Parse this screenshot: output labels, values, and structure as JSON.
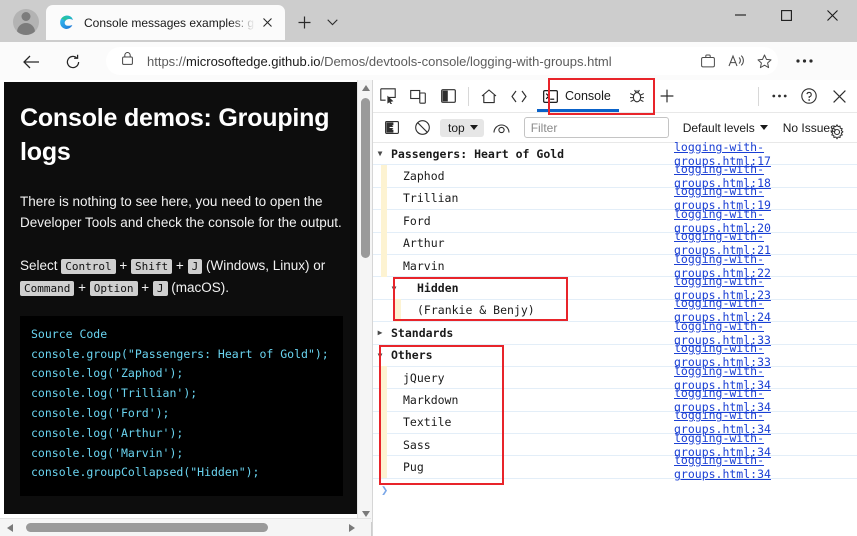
{
  "browser": {
    "tab": {
      "title": "Console messages examples: gro",
      "favicon": "edge-logo-icon",
      "close_label": "✕"
    },
    "newtab_label": "+",
    "window_controls": {
      "minimize": "—",
      "maximize": "□",
      "close": "✕"
    },
    "nav": {
      "back": "←",
      "reload": "⟳"
    },
    "url": {
      "prefix": "https://",
      "domain": "microsoftedge.github.io",
      "path": "/Demos/devtools-console/logging-with-groups.html"
    },
    "url_icons": [
      "collections-icon",
      "read-aloud-icon",
      "favorite-star-icon"
    ],
    "settings_label": "⋯"
  },
  "page": {
    "title": "Console demos: Grouping logs",
    "paragraph": "There is nothing to see here, you need to open the Developer Tools and check the console for the output.",
    "shortcut_prefix": "Select",
    "keys_windows": [
      "Control",
      "Shift",
      "J"
    ],
    "platform_windows": "(Windows, Linux) or",
    "keys_mac": [
      "Command",
      "Option",
      "J"
    ],
    "platform_mac": "(macOS).",
    "code_heading": "Source Code",
    "code": "console.group(\"Passengers: Heart of Gold\");\nconsole.log('Zaphod');\nconsole.log('Trillian');\nconsole.log('Ford');\nconsole.log('Arthur');\nconsole.log('Marvin');\nconsole.groupCollapsed(\"Hidden\");"
  },
  "devtools": {
    "toolbar_icons": [
      "inspect-element-icon",
      "device-emulation-icon",
      "dock-side-icon",
      "welcome-home-icon",
      "elements-code-icon"
    ],
    "active_tab": {
      "label": "Console",
      "icon": "console-terminal-icon"
    },
    "after_tab_icons": [
      "issues-bug-icon",
      "more-tools-plus-icon"
    ],
    "right_icons": [
      "more-options-icon",
      "help-question-icon",
      "close-devtools-icon"
    ],
    "filterbar": {
      "sidebar_toggle_icon": "console-sidebar-icon",
      "clear_icon": "clear-console-icon",
      "context": "top",
      "eye_icon": "live-expression-icon",
      "filter_placeholder": "Filter",
      "filter_value": "",
      "levels": "Default levels",
      "issues": "No Issues",
      "settings_icon": "gear-icon"
    },
    "prompt": "❯",
    "rows": [
      {
        "text": "Passengers: Heart of Gold",
        "source": "logging-with-groups.html:17",
        "kind": "group-open",
        "indent": 0
      },
      {
        "text": "Zaphod",
        "source": "logging-with-groups.html:18",
        "kind": "log",
        "indent": 1
      },
      {
        "text": "Trillian",
        "source": "logging-with-groups.html:19",
        "kind": "log",
        "indent": 1
      },
      {
        "text": "Ford",
        "source": "logging-with-groups.html:20",
        "kind": "log",
        "indent": 1
      },
      {
        "text": "Arthur",
        "source": "logging-with-groups.html:21",
        "kind": "log",
        "indent": 1
      },
      {
        "text": "Marvin",
        "source": "logging-with-groups.html:22",
        "kind": "log",
        "indent": 1
      },
      {
        "text": "Hidden",
        "source": "logging-with-groups.html:23",
        "kind": "group-open-nested",
        "indent": 1
      },
      {
        "text": "(Frankie & Benjy)",
        "source": "logging-with-groups.html:24",
        "kind": "log",
        "indent": 2
      },
      {
        "text": "Standards",
        "source": "logging-with-groups.html:33",
        "kind": "group-closed",
        "indent": 0
      },
      {
        "text": "Others",
        "source": "logging-with-groups.html:33",
        "kind": "group-open",
        "indent": 0
      },
      {
        "text": "jQuery",
        "source": "logging-with-groups.html:34",
        "kind": "log",
        "indent": 1
      },
      {
        "text": "Markdown",
        "source": "logging-with-groups.html:34",
        "kind": "log",
        "indent": 1
      },
      {
        "text": "Textile",
        "source": "logging-with-groups.html:34",
        "kind": "log",
        "indent": 1
      },
      {
        "text": "Sass",
        "source": "logging-with-groups.html:34",
        "kind": "log",
        "indent": 1
      },
      {
        "text": "Pug",
        "source": "logging-with-groups.html:34",
        "kind": "log",
        "indent": 1
      }
    ]
  },
  "annotations": {
    "color": "#e8242a",
    "boxes": [
      "console-tab-highlight",
      "hidden-group-highlight",
      "others-group-highlight"
    ]
  },
  "colors": {
    "accent_blue": "#0a62c9",
    "link_blue": "#1a3fd4",
    "group_gutter": "#fdf3d2",
    "row_divider": "#e3eef8",
    "chrome_bg": "#cdcdcd",
    "page_bg": "#0d0d0d"
  }
}
